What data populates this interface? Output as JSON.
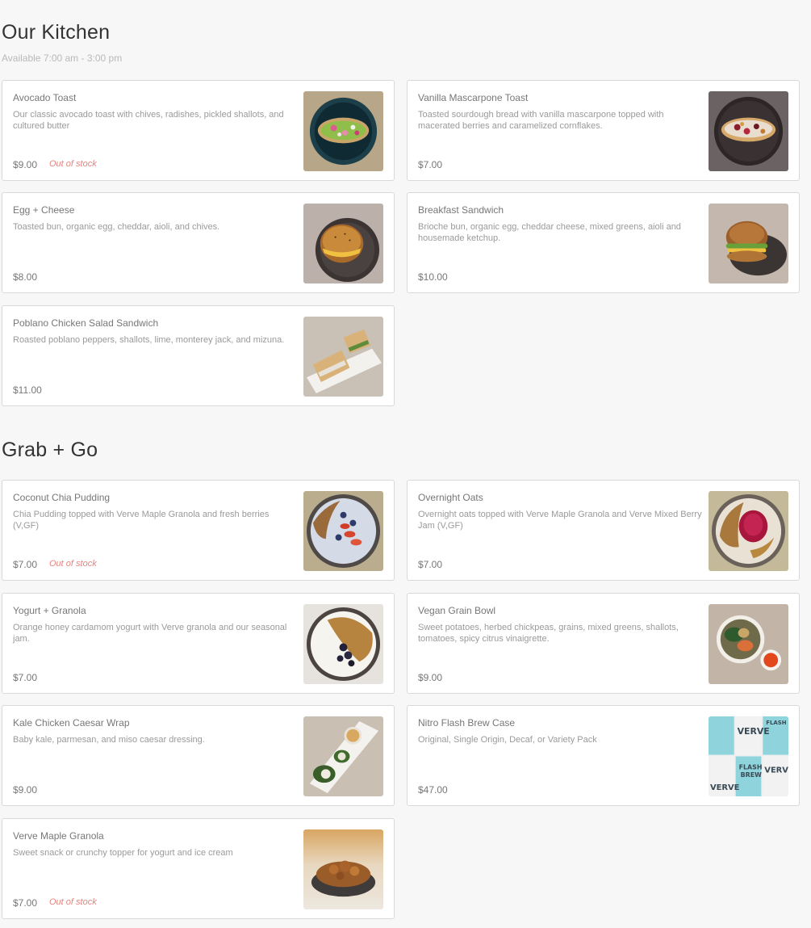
{
  "sections": {
    "kitchen": {
      "title": "Our Kitchen",
      "hours": "Available 7:00 am - 3:00 pm",
      "items": [
        {
          "name": "Avocado Toast",
          "description": "Our classic avocado toast with chives, radishes, pickled shallots, and cultured butter",
          "price": "$9.00",
          "stock": "Out of stock",
          "image": "avocado-toast-photo"
        },
        {
          "name": "Vanilla Mascarpone Toast",
          "description": "Toasted sourdough bread with vanilla mascarpone topped with macerated berries and caramelized cornflakes.",
          "price": "$7.00",
          "image": "mascarpone-toast-photo"
        },
        {
          "name": "Egg + Cheese",
          "description": "Toasted bun, organic egg, cheddar, aioli, and chives.",
          "price": "$8.00",
          "image": "egg-cheese-sandwich-photo"
        },
        {
          "name": "Breakfast Sandwich",
          "description": "Brioche bun, organic egg, cheddar cheese, mixed greens, aioli and housemade ketchup.",
          "price": "$10.00",
          "image": "breakfast-sandwich-photo"
        },
        {
          "name": "Poblano Chicken Salad Sandwich",
          "description": "Roasted poblano peppers, shallots, lime, monterey jack, and mizuna.",
          "price": "$11.00",
          "image": "poblano-sandwich-photo"
        }
      ]
    },
    "grab_go": {
      "title": "Grab + Go",
      "items": [
        {
          "name": "Coconut Chia Pudding",
          "description": "Chia Pudding topped with Verve Maple Granola and fresh berries (V,GF)",
          "price": "$7.00",
          "stock": "Out of stock",
          "image": "chia-pudding-photo"
        },
        {
          "name": "Overnight Oats",
          "description": "Overnight oats topped with Verve Maple Granola and Verve Mixed Berry Jam (V,GF)",
          "price": "$7.00",
          "image": "overnight-oats-photo"
        },
        {
          "name": "Yogurt + Granola",
          "description": "Orange honey cardamom yogurt with Verve granola and our seasonal jam.",
          "price": "$7.00",
          "image": "yogurt-granola-photo"
        },
        {
          "name": "Vegan Grain Bowl",
          "description": "Sweet potatoes, herbed chickpeas, grains, mixed greens, shallots, tomatoes, spicy citrus vinaigrette.",
          "price": "$9.00",
          "image": "grain-bowl-photo"
        },
        {
          "name": "Kale Chicken Caesar Wrap",
          "description": "Baby kale, parmesan, and miso caesar dressing.",
          "price": "$9.00",
          "image": "caesar-wrap-photo"
        },
        {
          "name": "Nitro Flash Brew Case",
          "description": "Original, Single Origin, Decaf, or Variety Pack",
          "price": "$47.00",
          "image": "flash-brew-cans-photo",
          "can_labels": [
            "VERVE",
            "FLASH",
            "BREW"
          ]
        },
        {
          "name": "Verve Maple Granola",
          "description": "Sweet snack or crunchy topper for yogurt and ice cream",
          "price": "$7.00",
          "stock": "Out of stock",
          "image": "maple-granola-photo"
        }
      ]
    }
  },
  "colors": {
    "background": "#f7f7f7",
    "card": "#ffffff",
    "border": "#d9d9d9",
    "out_of_stock": "#e2847e"
  }
}
